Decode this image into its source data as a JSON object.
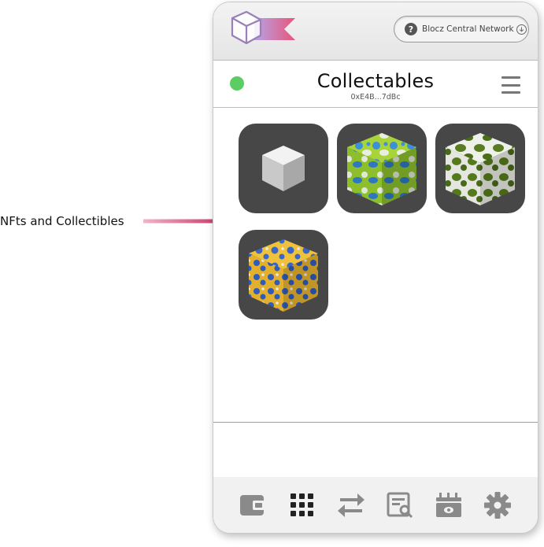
{
  "annotation": {
    "label": "NFts and Collectibles",
    "arrow_color": "#c8426a"
  },
  "topbar": {
    "logo_icon": "blocz-cube-flag-logo",
    "network_button": {
      "label": "Blocz Central Network",
      "help_icon": "question-icon",
      "dropdown_icon": "chevron-down-icon"
    }
  },
  "header": {
    "status_color": "#5ccd62",
    "title": "Collectables",
    "address": "0xE4B...7dBc",
    "menu_icon": "hamburger-menu-icon"
  },
  "collectibles": [
    {
      "name": "plain-grey-cube",
      "style": "grey"
    },
    {
      "name": "green-blue-camo-cube",
      "style": "green-blue"
    },
    {
      "name": "olive-white-camo-cube",
      "style": "olive-white"
    },
    {
      "name": "yellow-blue-camo-cube",
      "style": "yellow-blue"
    }
  ],
  "navbar": {
    "items": [
      {
        "icon": "wallet-icon",
        "active": false
      },
      {
        "icon": "grid-icon",
        "active": true
      },
      {
        "icon": "transfer-arrows-icon",
        "active": false
      },
      {
        "icon": "receipt-search-icon",
        "active": false
      },
      {
        "icon": "calendar-money-icon",
        "active": false
      },
      {
        "icon": "gear-icon",
        "active": false
      }
    ]
  },
  "colors": {
    "tile_bg": "#474747",
    "nav_active": "#222222",
    "nav_inactive": "#8a8a8a"
  }
}
